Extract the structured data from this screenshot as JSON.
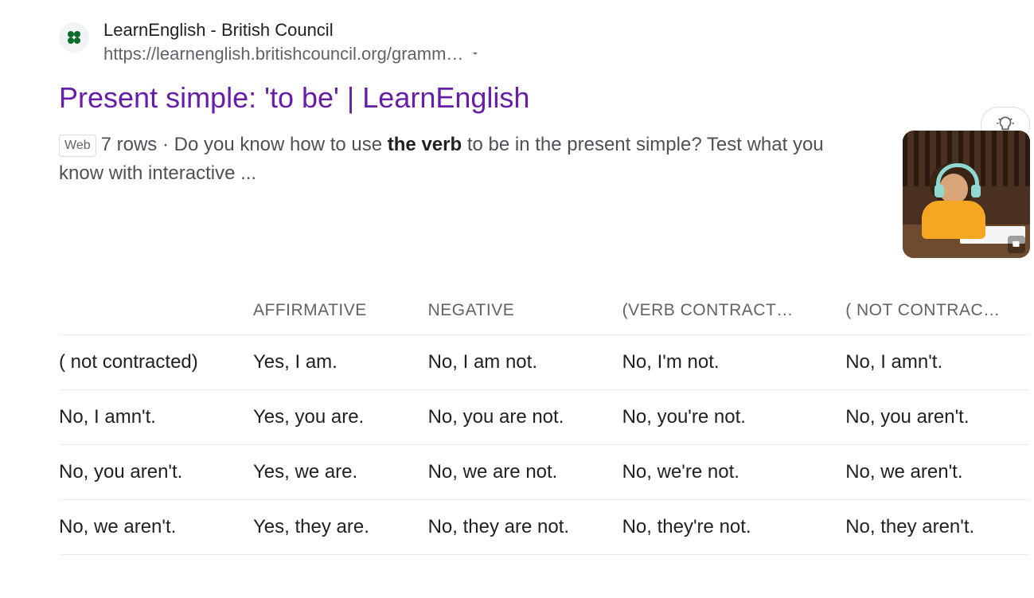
{
  "result": {
    "site_name": "LearnEnglish - British Council",
    "url_display": "https://learnenglish.britishcouncil.org/gramm…",
    "title": "Present simple: 'to be' | LearnEnglish",
    "snippet_chip": "Web",
    "snippet_prefix": "7 rows · Do you know how to use ",
    "snippet_bold": "the verb",
    "snippet_suffix": " to be in the present simple? Test what you know with interactive ...",
    "table": {
      "headers": [
        "",
        "AFFIRMATIVE",
        "NEGATIVE",
        "(VERB CONTRACT…",
        "( NOT CONTRAC…"
      ],
      "rows": [
        [
          "( not contracted)",
          "Yes, I am.",
          "No, I am not.",
          "No, I'm not.",
          "No, I amn't."
        ],
        [
          "No, I amn't.",
          "Yes, you are.",
          "No, you are not.",
          "No, you're not.",
          "No, you aren't."
        ],
        [
          "No, you aren't.",
          "Yes, we are.",
          "No, we are not.",
          "No, we're not.",
          "No, we aren't."
        ],
        [
          "No, we aren't.",
          "Yes, they are.",
          "No, they are not.",
          "No, they're not.",
          "No, they aren't."
        ]
      ]
    }
  }
}
